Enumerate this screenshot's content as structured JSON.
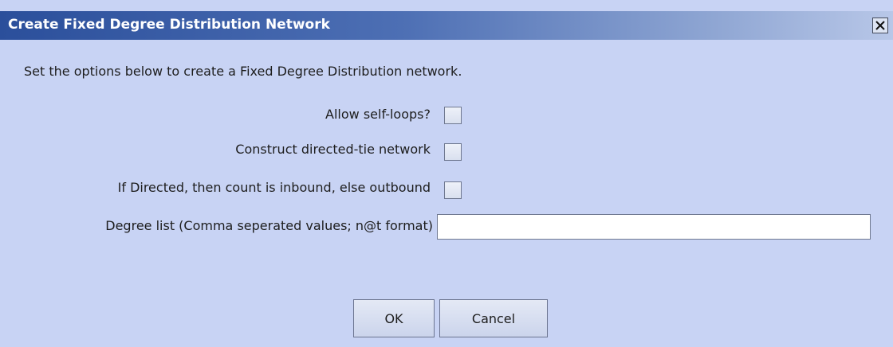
{
  "dialog": {
    "title": "Create Fixed Degree Distribution Network",
    "intro": "Set the options below to create a Fixed Degree Distribution network.",
    "options": [
      {
        "label": "Allow self-loops?",
        "checked": false
      },
      {
        "label": "Construct directed-tie network",
        "checked": false
      },
      {
        "label": "If Directed, then count is inbound, else outbound",
        "checked": false
      }
    ],
    "degree_list": {
      "label": "Degree list (Comma seperated values; n@t format)",
      "value": ""
    },
    "buttons": {
      "ok": "OK",
      "cancel": "Cancel"
    }
  }
}
